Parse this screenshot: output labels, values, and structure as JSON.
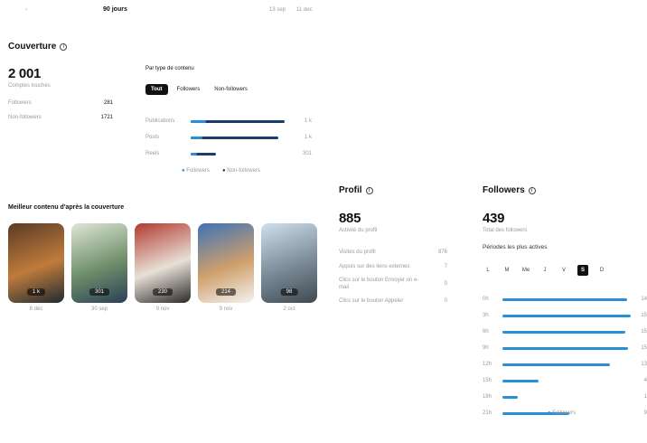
{
  "header": {
    "period": "90 jours",
    "range_start": "13 sep",
    "range_end": "11 dec"
  },
  "coverage": {
    "title": "Couverture",
    "total": "2 001",
    "total_label": "Comptes touchés",
    "rows": [
      {
        "label": "Followers",
        "value": "281"
      },
      {
        "label": "Non-followers",
        "value": "1721"
      }
    ],
    "by_type_title": "Par type de contenu",
    "filters": [
      "Tout",
      "Followers",
      "Non-followers"
    ],
    "types": [
      {
        "label": "Publications",
        "value": "1 k",
        "followers": 0.15,
        "total": 0.93
      },
      {
        "label": "Posts",
        "value": "1 k",
        "followers": 0.12,
        "total": 0.87
      },
      {
        "label": "Reels",
        "value": "301",
        "followers": 0.06,
        "total": 0.25
      }
    ],
    "legend": [
      "Followers",
      "Non-followers"
    ]
  },
  "best_content": {
    "title": "Meilleur contenu d'après la couverture",
    "items": [
      {
        "badge": "1 k",
        "date": "8 déc",
        "palette": [
          "#5a3b26",
          "#c07b3b",
          "#1f2b33"
        ]
      },
      {
        "badge": "301",
        "date": "30 sep",
        "palette": [
          "#dfe6d6",
          "#6f8f6a",
          "#2b3f56"
        ]
      },
      {
        "badge": "230",
        "date": "9 nov",
        "palette": [
          "#b33a2f",
          "#e7e0d6",
          "#2a2a2a"
        ]
      },
      {
        "badge": "214",
        "date": "9 nov",
        "palette": [
          "#3d72b8",
          "#d0a06b",
          "#f3f3f3"
        ]
      },
      {
        "badge": "98",
        "date": "2 oct",
        "palette": [
          "#cfe0ee",
          "#7a8a96",
          "#3e4a52"
        ]
      }
    ]
  },
  "profile": {
    "title": "Profil",
    "total": "885",
    "total_label": "Activité du profil",
    "rows": [
      {
        "label": "Visites du profil",
        "value": "876"
      },
      {
        "label": "Appuis sur des liens externes",
        "value": "7"
      },
      {
        "label": "Clics sur le bouton Envoyer un e-mail",
        "value": "0"
      },
      {
        "label": "Clics sur le bouton Appeler",
        "value": "0"
      }
    ]
  },
  "followers": {
    "title": "Followers",
    "total": "439",
    "total_label": "Total des followers",
    "active_title": "Périodes les plus actives",
    "days": [
      "L",
      "M",
      "Me",
      "J",
      "V",
      "S",
      "D"
    ],
    "active_day": "S",
    "hours": [
      {
        "label": "0h",
        "value": "14",
        "ratio": 0.97
      },
      {
        "label": "3h",
        "value": "15",
        "ratio": 1.0
      },
      {
        "label": "6h",
        "value": "15",
        "ratio": 0.96
      },
      {
        "label": "9h",
        "value": "15",
        "ratio": 0.98
      },
      {
        "label": "12h",
        "value": "13",
        "ratio": 0.84
      },
      {
        "label": "15h",
        "value": "4",
        "ratio": 0.28
      },
      {
        "label": "18h",
        "value": "1",
        "ratio": 0.12
      },
      {
        "label": "21h",
        "value": "9",
        "ratio": 0.52
      }
    ],
    "legend": "Followers"
  }
}
